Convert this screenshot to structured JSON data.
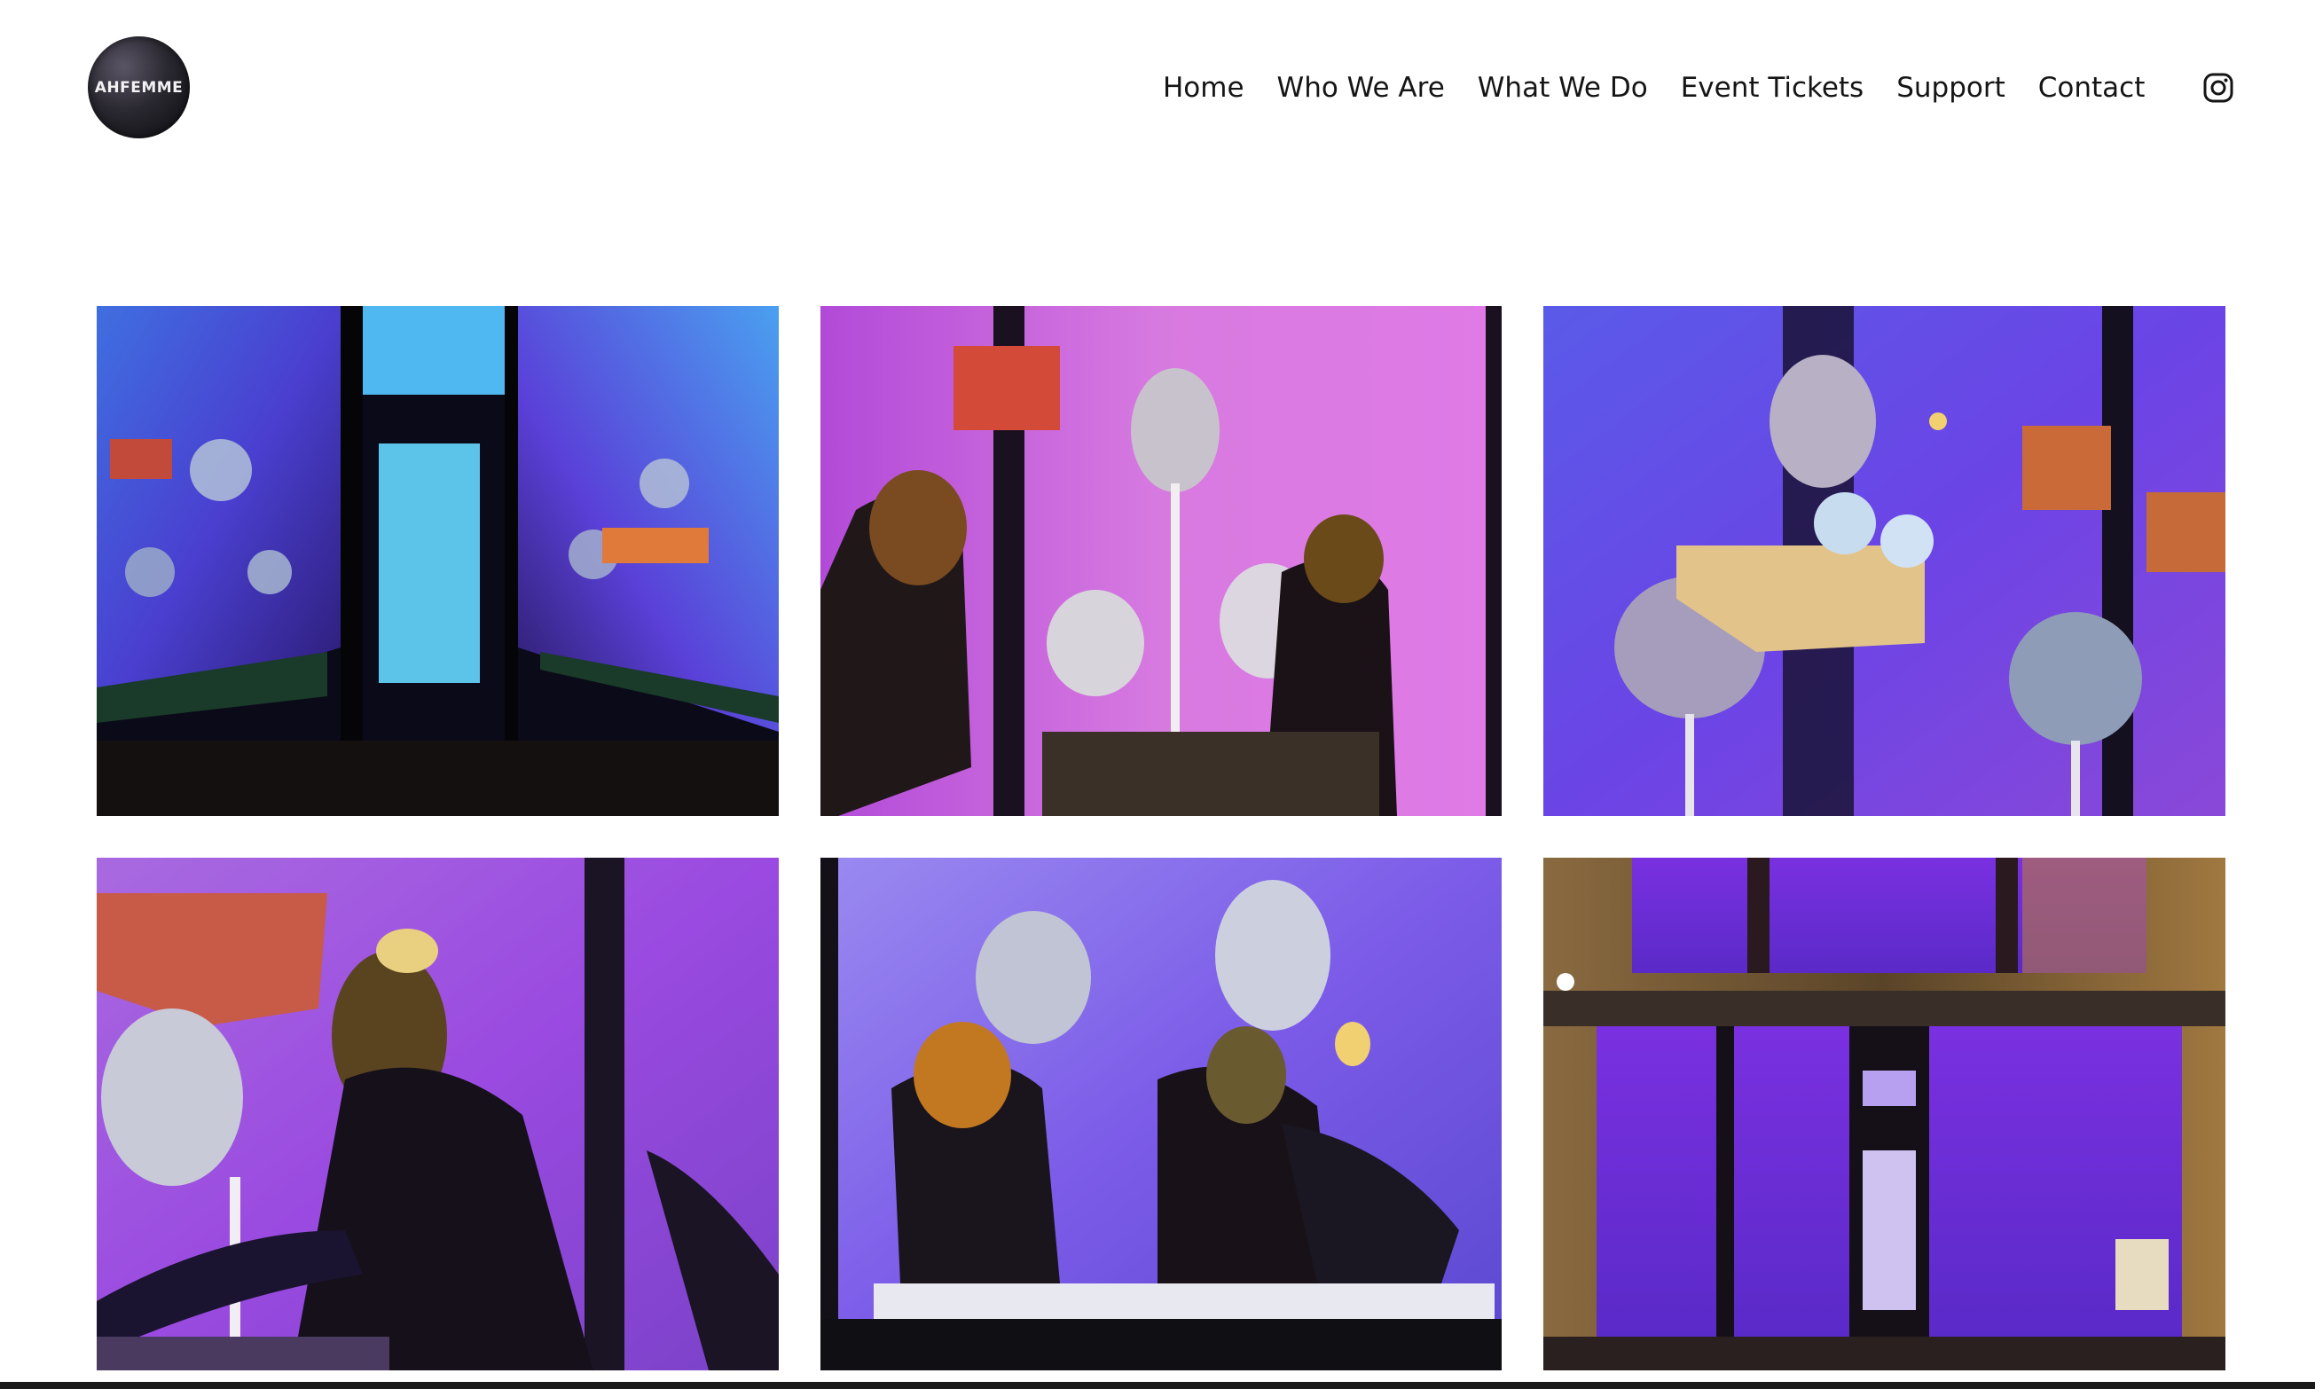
{
  "site": {
    "logo_text": "AHFEMME"
  },
  "nav": {
    "items": [
      {
        "label": "Home"
      },
      {
        "label": "Who We Are"
      },
      {
        "label": "What We Do"
      },
      {
        "label": "Event Tickets"
      },
      {
        "label": "Support"
      },
      {
        "label": "Contact"
      }
    ],
    "social_icon": "instagram-icon"
  },
  "gallery": {
    "photos": [
      {
        "subject": "storefront-window-corner",
        "tone": "#4a3fd0"
      },
      {
        "subject": "bee-mannequins-poppies",
        "tone": "#c24fd6"
      },
      {
        "subject": "poppy-pods-honeycomb",
        "tone": "#6b44e6"
      },
      {
        "subject": "bee-mannequin-closeup",
        "tone": "#9a4ae0"
      },
      {
        "subject": "two-bee-mannequins",
        "tone": "#7b5be8"
      },
      {
        "subject": "storefront-exterior-night",
        "tone": "#6a2ad8"
      }
    ]
  },
  "colors": {
    "background": "#ffffff",
    "text": "#151515"
  }
}
